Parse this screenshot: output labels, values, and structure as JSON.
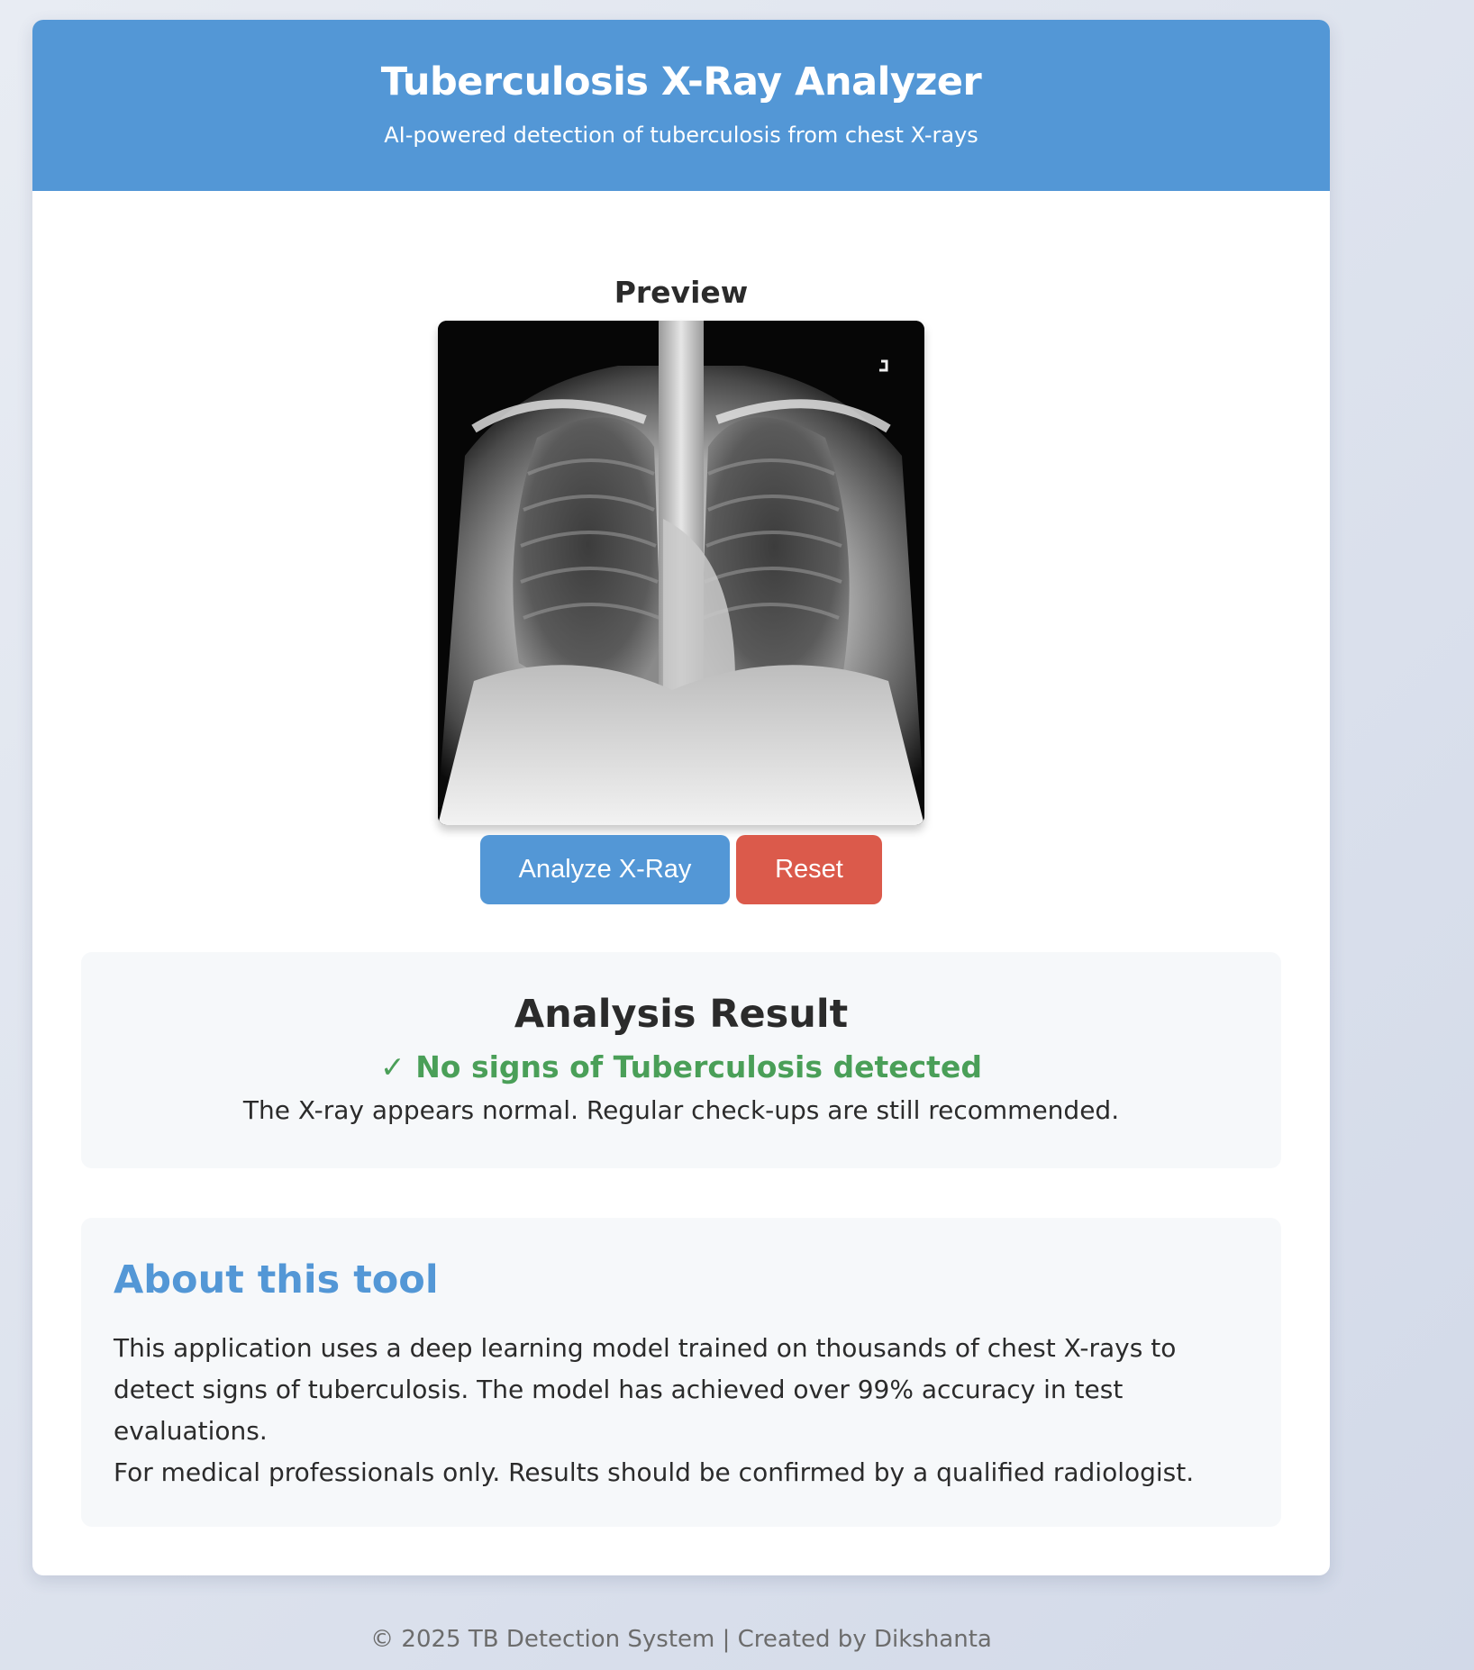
{
  "header": {
    "title": "Tuberculosis X-Ray Analyzer",
    "subtitle": "AI-powered detection of tuberculosis from chest X-rays"
  },
  "preview": {
    "title": "Preview",
    "image_icon": "chest-xray-image"
  },
  "actions": {
    "analyze_label": "Analyze X-Ray",
    "reset_label": "Reset"
  },
  "result": {
    "title": "Analysis Result",
    "status_icon": "✓",
    "status_text": "No signs of Tuberculosis detected",
    "detail": "The X-ray appears normal. Regular check-ups are still recommended."
  },
  "about": {
    "title": "About this tool",
    "paragraph": "This application uses a deep learning model trained on thousands of chest X-rays to detect signs of tuberculosis. The model has achieved over 99% accuracy in test evaluations.",
    "disclaimer": "For medical professionals only. Results should be confirmed by a qualified radiologist."
  },
  "footer": {
    "text": "© 2025 TB Detection System | Created by Dikshanta"
  },
  "colors": {
    "primary": "#5397d6",
    "danger": "#db5a4b",
    "success": "#4a9f58",
    "panel": "#f6f8fa"
  }
}
